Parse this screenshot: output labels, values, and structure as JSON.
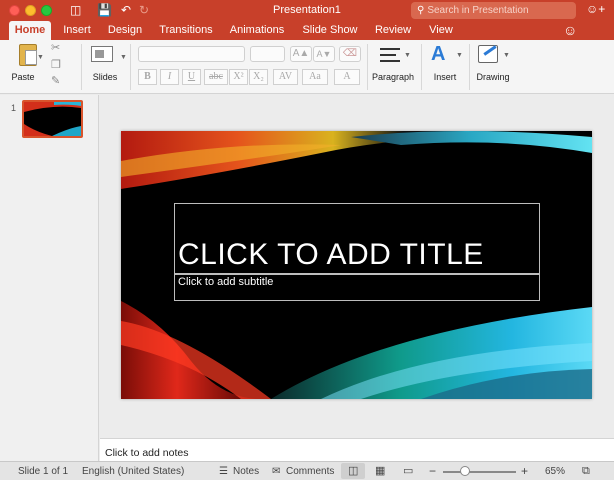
{
  "window": {
    "title": "Presentation1",
    "search_placeholder": "Search in Presentation"
  },
  "tabs": [
    {
      "label": "Home",
      "active": true
    },
    {
      "label": "Insert"
    },
    {
      "label": "Design"
    },
    {
      "label": "Transitions"
    },
    {
      "label": "Animations"
    },
    {
      "label": "Slide Show"
    },
    {
      "label": "Review"
    },
    {
      "label": "View"
    }
  ],
  "ribbon": {
    "paste_label": "Paste",
    "slides_label": "Slides",
    "paragraph_label": "Paragraph",
    "insert_label": "Insert",
    "drawing_label": "Drawing",
    "format_buttons": [
      "B",
      "I",
      "U",
      "abc",
      "X²",
      "X₂",
      "AV",
      "Aa",
      "A"
    ]
  },
  "thumbnails": [
    {
      "number": "1"
    }
  ],
  "slide": {
    "title_placeholder": "CLICK TO ADD TITLE",
    "subtitle_placeholder": "Click to add subtitle"
  },
  "notes_placeholder": "Click to add notes",
  "status": {
    "slide_count": "Slide 1 of 1",
    "language": "English (United States)",
    "notes_label": "Notes",
    "comments_label": "Comments",
    "zoom_level": "65%",
    "zoom_fraction": 0.3
  },
  "colors": {
    "accent": "#c8402a",
    "slide_background": "#000000"
  }
}
